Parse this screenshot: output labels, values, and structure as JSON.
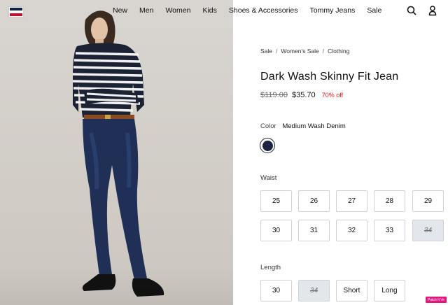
{
  "nav": {
    "items": [
      "New",
      "Men",
      "Women",
      "Kids",
      "Shoes & Accessories",
      "Tommy Jeans",
      "Sale"
    ],
    "icons": [
      "search-icon",
      "account-icon"
    ]
  },
  "brand": {
    "flag_colors": [
      "#10234f",
      "#ffffff",
      "#c8102e"
    ]
  },
  "product": {
    "breadcrumbs": [
      "Sale",
      "Women's Sale",
      "Clothing"
    ],
    "title": "Dark Wash Skinny Fit Jean",
    "original_price": "$119.00",
    "sale_price": "$35.70",
    "discount": "70% off",
    "color_label": "Color",
    "color_value": "Medium Wash Denim",
    "swatch_color": "#1a2540",
    "waist_label": "Waist",
    "waist_sizes": [
      {
        "label": "25",
        "available": true
      },
      {
        "label": "26",
        "available": true
      },
      {
        "label": "27",
        "available": true
      },
      {
        "label": "28",
        "available": true
      },
      {
        "label": "29",
        "available": true
      },
      {
        "label": "30",
        "available": true
      },
      {
        "label": "31",
        "available": true
      },
      {
        "label": "32",
        "available": true
      },
      {
        "label": "33",
        "available": true
      },
      {
        "label": "34",
        "available": false
      }
    ],
    "length_label": "Length",
    "lengths": [
      {
        "label": "30",
        "available": true
      },
      {
        "label": "34",
        "available": false
      },
      {
        "label": "Short",
        "available": true
      },
      {
        "label": "Long",
        "available": true
      }
    ]
  },
  "badge": "Patch It Ve"
}
